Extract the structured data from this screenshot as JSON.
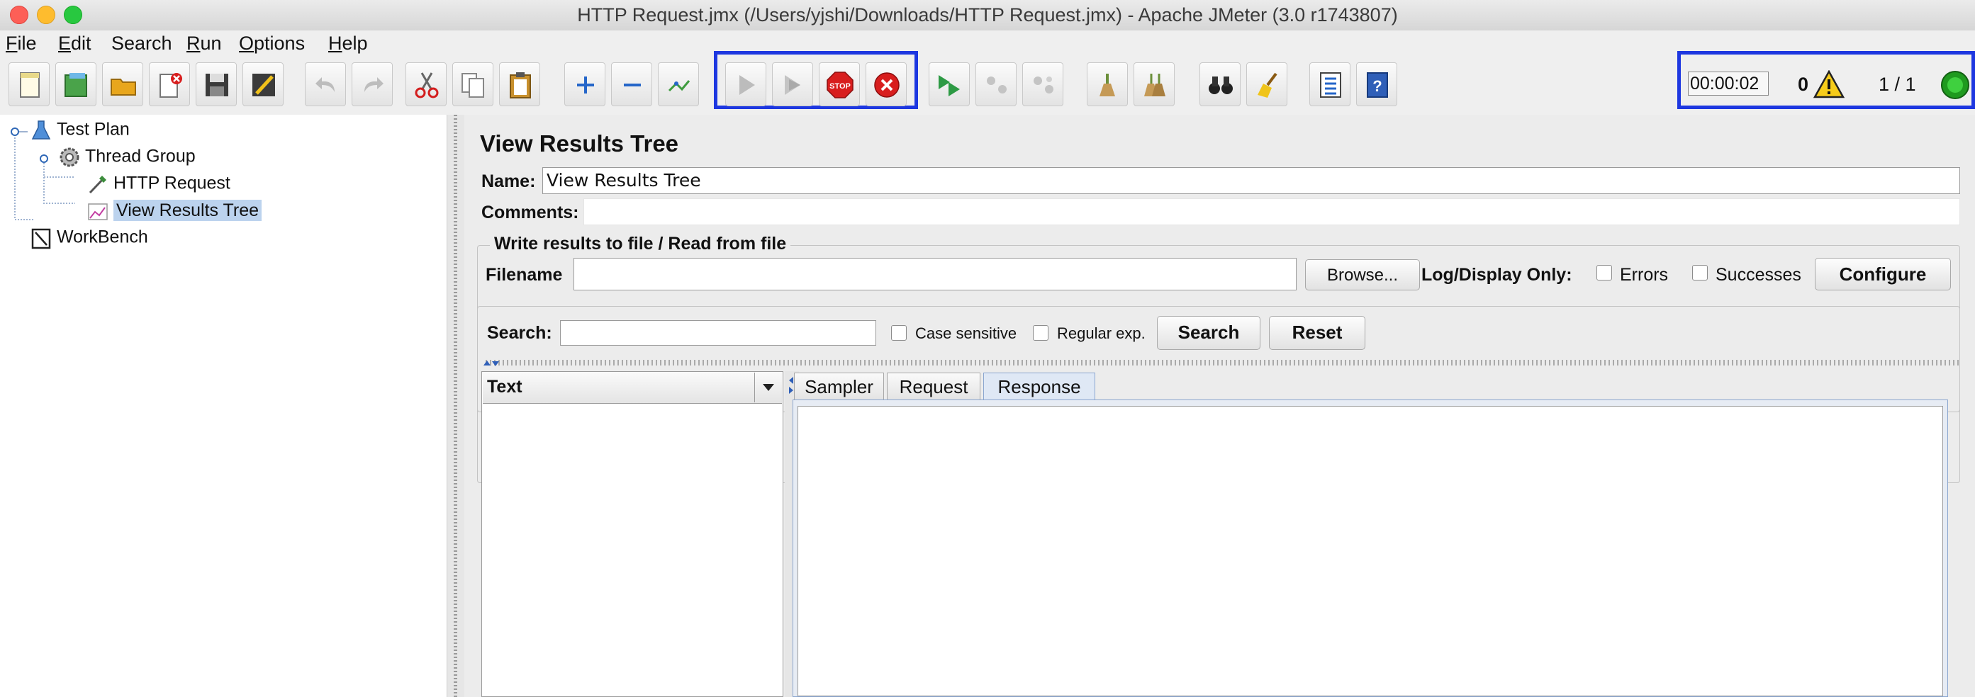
{
  "window": {
    "title": "HTTP Request.jmx (/Users/yjshi/Downloads/HTTP Request.jmx) - Apache JMeter (3.0 r1743807)"
  },
  "menu": [
    {
      "label": "File",
      "u": "F",
      "rest": "ile"
    },
    {
      "label": "Edit",
      "u": "E",
      "rest": "dit"
    },
    {
      "label": "Search",
      "u": "",
      "rest": "Search"
    },
    {
      "label": "Run",
      "u": "R",
      "rest": "un"
    },
    {
      "label": "Options",
      "u": "O",
      "rest": "ptions"
    },
    {
      "label": "Help",
      "u": "H",
      "rest": "elp"
    }
  ],
  "toolbar": {
    "buttons": [
      "new",
      "templates",
      "open",
      "close",
      "save",
      "save-as",
      "undo",
      "redo",
      "cut",
      "copy",
      "paste",
      "expand",
      "collapse",
      "toggle",
      "start",
      "start-no-pause",
      "stop",
      "shutdown",
      "remote-start",
      "remote-stop",
      "remote-shutdown",
      "clear",
      "clear-all",
      "search",
      "reset-search",
      "function-helper",
      "help"
    ],
    "timer": "00:00:02",
    "error_count": "0",
    "threads": "1 / 1"
  },
  "tree": [
    {
      "label": "Test Plan",
      "icon": "test-plan-icon"
    },
    {
      "label": "Thread Group",
      "icon": "thread-group-icon"
    },
    {
      "label": "HTTP Request",
      "icon": "sampler-icon"
    },
    {
      "label": "View Results Tree",
      "icon": "listener-icon",
      "selected": true
    },
    {
      "label": "WorkBench",
      "icon": "workbench-icon"
    }
  ],
  "panel": {
    "title": "View Results Tree",
    "name_label": "Name:",
    "name_value": "View Results Tree",
    "comments_label": "Comments:",
    "file_group_title": "Write results to file / Read from file",
    "filename_label": "Filename",
    "browse_label": "Browse...",
    "log_display_label": "Log/Display Only:",
    "errors_label": "Errors",
    "successes_label": "Successes",
    "configure_label": "Configure",
    "search_label": "Search:",
    "case_sensitive_label": "Case sensitive",
    "regex_label": "Regular exp.",
    "search_button": "Search",
    "reset_button": "Reset",
    "renderer_selected": "Text",
    "tabs": [
      "Sampler result",
      "Request",
      "Response data"
    ],
    "active_tab": "Response data"
  },
  "colors": {
    "highlight": "#1d37e0",
    "selection": "#bcd3ee",
    "status_ok": "#2fb52f"
  }
}
